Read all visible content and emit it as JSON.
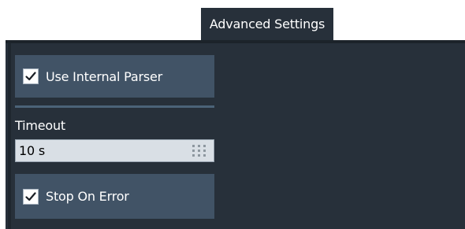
{
  "tab": {
    "label": "Advanced Settings"
  },
  "use_internal_parser": {
    "label": "Use Internal Parser",
    "checked": true
  },
  "timeout": {
    "label": "Timeout",
    "value": "10 s"
  },
  "stop_on_error": {
    "label": "Stop On Error",
    "checked": true
  },
  "colors": {
    "panel": "#27303a",
    "tile": "#415366",
    "divider": "#4b6378",
    "field": "#d9dfe5"
  },
  "icons": {
    "checkbox": "check-icon",
    "numeric_keypad": "keypad-icon"
  }
}
